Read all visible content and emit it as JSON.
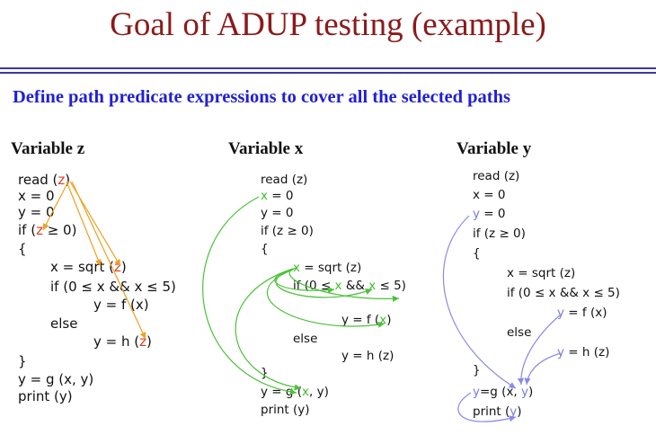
{
  "slide": {
    "title": "Goal of ADUP testing (example)",
    "subtitle": "Define path predicate expressions to cover all the selected paths"
  },
  "columns": {
    "z": {
      "heading": "Variable z",
      "read_pre": "read (",
      "read_var": "z",
      "read_post": ")",
      "x0": "x = 0",
      "y0_pre": "y = 0",
      "if_pre": "if (",
      "if_var": "z",
      "if_post": " ≥ 0)",
      "brace_open": "{",
      "sqrt_pre": "x = sqrt (",
      "sqrt_var": "z",
      "sqrt_post": ")",
      "inner_if": "if (0 ≤ x && x ≤ 5)",
      "yf": "y = f (x)",
      "else": "else",
      "yh_pre": "y = h (",
      "yh_var": "z",
      "yh_post": ")",
      "brace_close": "}",
      "yg": "y = g (x, y)",
      "print": "print (y)"
    },
    "x": {
      "heading": "Variable x",
      "read": "read (z)",
      "x0_var": "x",
      "x0_post": " = 0",
      "y0": "y = 0",
      "if": "if (z ≥ 0)",
      "brace_open": "{",
      "sqrt_var": "x",
      "sqrt_post": " = sqrt (z)",
      "inner_if_a": "if (0 ≤ ",
      "inner_if_v1": "x",
      "inner_if_b": " && ",
      "inner_if_v2": "x",
      "inner_if_c": " ≤ 5)",
      "yf_pre": "y = f (",
      "yf_var": "x",
      "yf_post": ")",
      "else": "else",
      "yh": "y = h (z)",
      "brace_close": "}",
      "yg_pre": "y = g (",
      "yg_var": "x",
      "yg_post": ", y)",
      "print": "print (y)"
    },
    "y": {
      "heading": "Variable y",
      "read": "read (z)",
      "x0": "x = 0",
      "y0_var": "y",
      "y0_post": " = 0",
      "if": "if (z ≥ 0)",
      "brace_open": "{",
      "sqrt": "x = sqrt (z)",
      "inner_if": "if (0 ≤ x && x ≤ 5)",
      "yf_var": "y",
      "yf_post": " = f (x)",
      "else": "else",
      "yh_var": "y",
      "yh_post": " = h (z)",
      "brace_close": "}",
      "yg_var": "y",
      "yg_mid": "=g (x, ",
      "yg_var2": "y",
      "yg_post": ")",
      "print_pre": "print (",
      "print_var": "y",
      "print_post": ")"
    }
  },
  "colors": {
    "title": "#8B1A1A",
    "subtitle": "#1f1fd6",
    "z_arrows": "#f0a020",
    "x_arrows": "#4cc23a",
    "y_arrows": "#8a8ae6"
  }
}
